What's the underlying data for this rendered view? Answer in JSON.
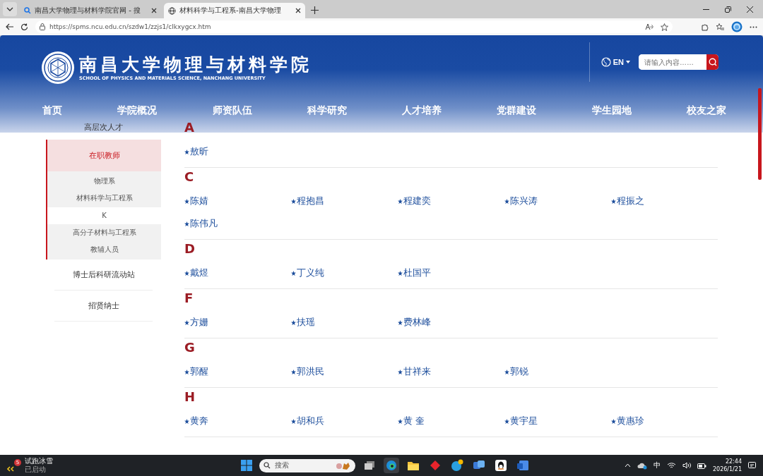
{
  "browser": {
    "tabs": [
      {
        "title": "南昌大学物理与材料学院官网 - 搜",
        "selected": false
      },
      {
        "title": "材料科学与工程系-南昌大学物理",
        "selected": true
      }
    ],
    "url": "https://spms.ncu.edu.cn/szdw1/zzjs1/clkxygcx.htm"
  },
  "header": {
    "title": "南昌大学物理与材料学院",
    "subtitle": "SCHOOL OF PHYSICS AND MATERIALS SCIENCE, NANCHANG UNIVERSITY",
    "language": "EN",
    "language_menu_expanded": false,
    "search_placeholder": "请输入内容……",
    "nav": [
      "首页",
      "学院概况",
      "师资队伍",
      "科学研究",
      "人才培养",
      "党群建设",
      "学生园地",
      "校友之家"
    ]
  },
  "sidebar": {
    "items": [
      {
        "label": "高层次人才",
        "selected": false
      },
      {
        "label": "在职教师",
        "selected": true,
        "children": [
          {
            "label": "物理系",
            "highlighted": false
          },
          {
            "label": "材料科学与工程系",
            "highlighted": false
          },
          {
            "label": "K",
            "highlighted": true
          },
          {
            "label": "高分子材料与工程系",
            "highlighted": false
          },
          {
            "label": "教辅人员",
            "highlighted": false
          }
        ]
      },
      {
        "label": "博士后科研流动站",
        "selected": false
      },
      {
        "label": "招贤纳士",
        "selected": false
      }
    ]
  },
  "sections": [
    {
      "letter": "A",
      "names": [
        "敖昕"
      ]
    },
    {
      "letter": "C",
      "names": [
        "陈婧",
        "程抱昌",
        "程建奕",
        "陈兴涛",
        "程振之",
        "陈伟凡"
      ]
    },
    {
      "letter": "D",
      "names": [
        "戴煜",
        "丁义纯",
        "杜国平"
      ]
    },
    {
      "letter": "F",
      "names": [
        "方姗",
        "扶瑶",
        "费林峰"
      ]
    },
    {
      "letter": "G",
      "names": [
        "郭醒",
        "郭洪民",
        "甘祥来",
        "郭锐"
      ]
    },
    {
      "letter": "H",
      "names": [
        "黄奔",
        "胡和兵",
        "黄 奎",
        "黄宇星",
        "黄惠珍"
      ]
    }
  ],
  "taskbar": {
    "widget": {
      "badge": "5",
      "title": "试跑冰雪",
      "status": "已启动"
    },
    "search_placeholder": "搜索",
    "ime": "中",
    "time": "22:44",
    "date": "2026/1/21"
  }
}
